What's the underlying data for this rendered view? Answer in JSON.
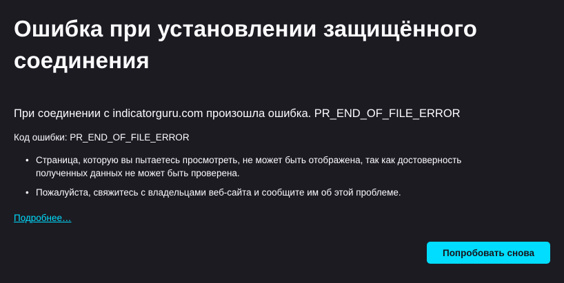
{
  "page": {
    "title": "Ошибка при установлении защищённого соединения",
    "short_description": "При соединении с indicatorguru.com произошла ошибка. PR_END_OF_FILE_ERROR",
    "error_code_line": "Код ошибки: PR_END_OF_FILE_ERROR",
    "details": [
      "Страница, которую вы пытаетесь просмотреть, не может быть отображена, так как достоверность полученных данных не может быть проверена.",
      "Пожалуйста, свяжитесь с владельцами веб-сайта и сообщите им об этой проблеме."
    ],
    "learn_more_label": "Подробнее…",
    "retry_label": "Попробовать снова"
  },
  "colors": {
    "background": "#1c1b22",
    "text": "#fbfbfe",
    "accent": "#00ddff"
  }
}
